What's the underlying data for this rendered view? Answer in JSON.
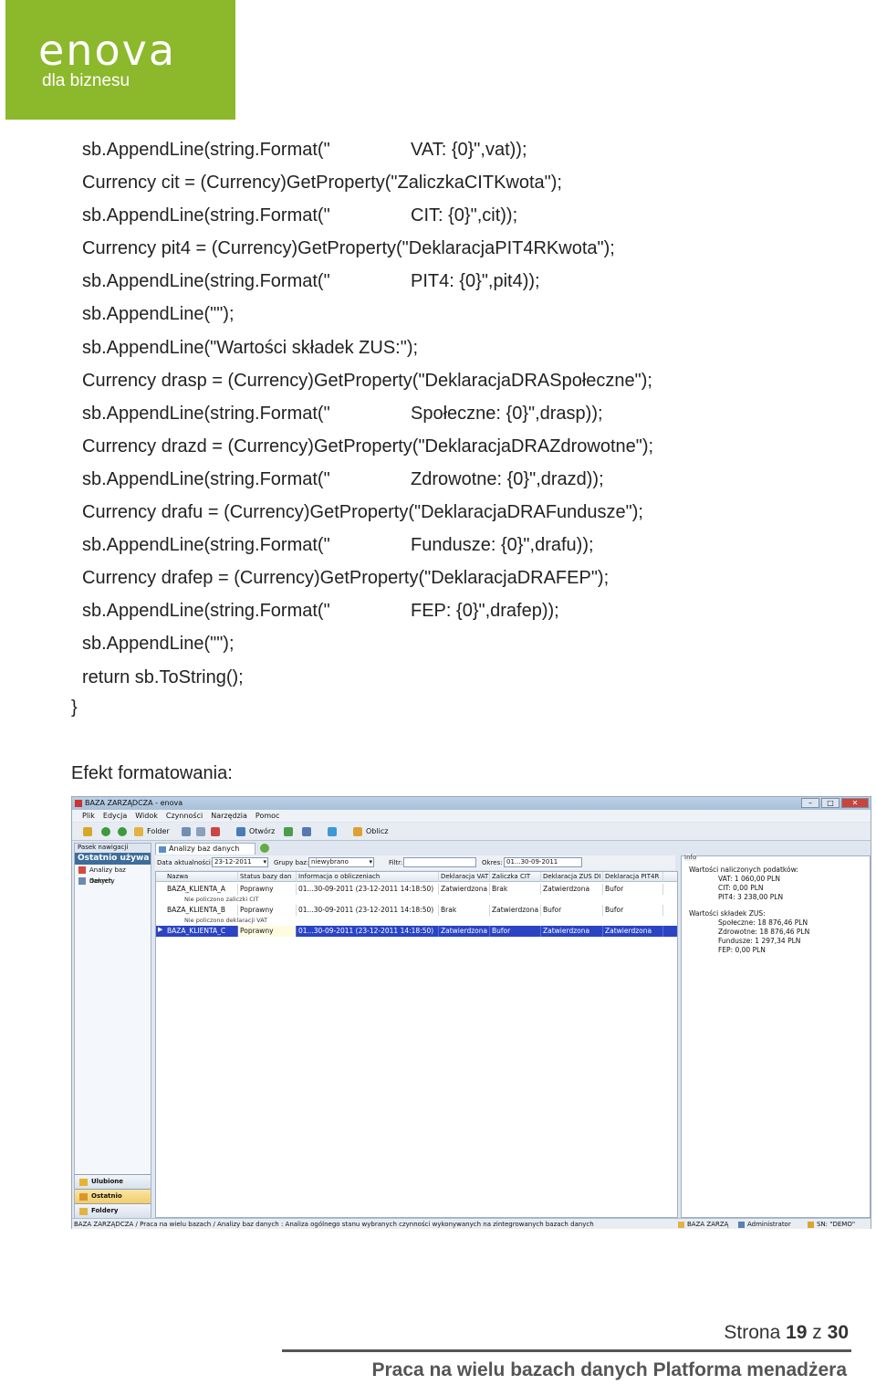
{
  "logo": {
    "word": "enova",
    "sub": "dla biznesu"
  },
  "code_lines": [
    {
      "a": "sb.AppendLine(string.Format(\"",
      "b": "VAT: {0}\",vat));"
    },
    {
      "a": "Currency cit = (Currency)GetProperty(\"ZaliczkaCITKwota\");",
      "b": ""
    },
    {
      "a": "sb.AppendLine(string.Format(\"",
      "b": "CIT: {0}\",cit));"
    },
    {
      "a": "Currency pit4 = (Currency)GetProperty(\"DeklaracjaPIT4RKwota\");",
      "b": ""
    },
    {
      "a": "sb.AppendLine(string.Format(\"",
      "b": "PIT4: {0}\",pit4));"
    },
    {
      "a": "sb.AppendLine(\"\");",
      "b": ""
    },
    {
      "a": "sb.AppendLine(\"Wartości składek ZUS:\");",
      "b": ""
    },
    {
      "a": "Currency drasp = (Currency)GetProperty(\"DeklaracjaDRASpołeczne\");",
      "b": ""
    },
    {
      "a": "sb.AppendLine(string.Format(\"",
      "b": "Społeczne: {0}\",drasp));"
    },
    {
      "a": "Currency drazd = (Currency)GetProperty(\"DeklaracjaDRAZdrowotne\");",
      "b": ""
    },
    {
      "a": "sb.AppendLine(string.Format(\"",
      "b": "Zdrowotne: {0}\",drazd));"
    },
    {
      "a": "Currency drafu = (Currency)GetProperty(\"DeklaracjaDRAFundusze\");",
      "b": ""
    },
    {
      "a": "sb.AppendLine(string.Format(\"",
      "b": "Fundusze: {0}\",drafu));"
    },
    {
      "a": "Currency drafep = (Currency)GetProperty(\"DeklaracjaDRAFEP\");",
      "b": ""
    },
    {
      "a": "sb.AppendLine(string.Format(\"",
      "b": "FEP: {0}\",drafep));"
    },
    {
      "a": "sb.AppendLine(\"\");",
      "b": ""
    },
    {
      "a": "return sb.ToString();",
      "b": ""
    }
  ],
  "closing_brace": "}",
  "caption": "Efekt formatowania:",
  "app": {
    "title": "BAZA ZARZĄDCZA - enova",
    "menu": [
      "Plik",
      "Edycja",
      "Widok",
      "Czynności",
      "Narzędzia",
      "Pomoc"
    ],
    "toolbar": {
      "folder": "Folder",
      "open": "Otwórz",
      "calc": "Oblicz"
    },
    "nav": {
      "panel_title": "Pasek nawigacji",
      "recent_header": "Ostatnio używa",
      "items": [
        "Analizy baz danych",
        "Dekrety"
      ],
      "panes": [
        "Ulubione",
        "Ostatnio używan",
        "Foldery"
      ]
    },
    "tab": "Analizy baz danych",
    "filter": {
      "date_label": "Data aktualności:",
      "date_value": "23-12-2011",
      "group_label": "Grupy baz:",
      "group_value": "niewybrano",
      "filter_label": "Filtr:",
      "filter_value": "",
      "period_label": "Okres:",
      "period_value": "01...30-09-2011"
    },
    "columns": [
      "Nazwa",
      "Status bazy dan",
      "Informacja o obliczeniach",
      "Deklaracja VAT",
      "Zaliczka CIT",
      "Deklaracja ZUS DI",
      "Deklaracja PIT4R"
    ],
    "rows": [
      {
        "cells": [
          "BAZA_KLIENTA_A",
          "Poprawny",
          "01...30-09-2011 (23-12-2011 14:18:50)",
          "Zatwierdzona",
          "Brak",
          "Zatwierdzona",
          "Bufor"
        ],
        "note": "Nie policzono zaliczki CIT"
      },
      {
        "cells": [
          "BAZA_KLIENTA_B",
          "Poprawny",
          "01...30-09-2011 (23-12-2011 14:18:50)",
          "Brak",
          "Zatwierdzona",
          "Bufor",
          "Bufor"
        ],
        "note": "Nie policzono deklaracji VAT"
      },
      {
        "cells": [
          "BAZA_KLIENTA_C",
          "Poprawny",
          "01...30-09-2011 (23-12-2011 14:18:50)",
          "Zatwierdzona",
          "Bufor",
          "Zatwierdzona",
          "Zatwierdzona"
        ],
        "note": ""
      }
    ],
    "row_marker": "▶",
    "info": {
      "title": "Info",
      "lines": [
        "Wartości naliczonych podatków:",
        "VAT: 1 060,00 PLN",
        "CIT: 0,00 PLN",
        "PIT4: 3 238,00 PLN",
        "Wartości składek ZUS:",
        "Społeczne: 18 876,46 PLN",
        "Zdrowotne: 18 876,46 PLN",
        "Fundusze: 1 297,34 PLN",
        "FEP: 0,00 PLN"
      ]
    },
    "status": {
      "path": "BAZA ZARZĄDCZA / Praca na wielu bazach / Analizy baz danych : Analiza ogólnego stanu wybranych czynności wykonywanych na zintegrowanych bazach danych",
      "db": "BAZA ZARZĄ",
      "user": "Administrator",
      "sn": "SN: \"DEMO\""
    }
  },
  "footer": {
    "page_prefix": "Strona",
    "page_num": "19",
    "page_sep": "z",
    "page_total": "30",
    "title": "Praca na wielu bazach danych Platforma menadżera"
  },
  "colors": {
    "logo_green": "#8cb82b",
    "selection_blue": "#2a44c4"
  }
}
